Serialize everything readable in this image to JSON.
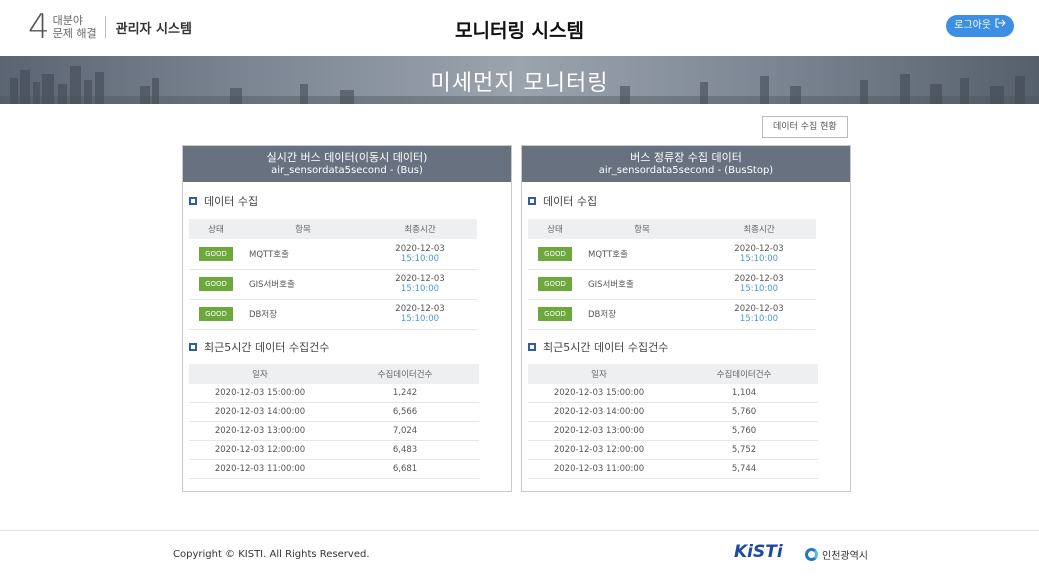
{
  "header": {
    "logo_number": "4",
    "logo_line1": "대분야",
    "logo_line2": "문제 해결",
    "admin_label": "관리자 시스템",
    "title": "모니터링 시스템",
    "logout_label": "로그아웃"
  },
  "banner": {
    "title": "미세먼지 모니터링"
  },
  "status_button": "데이터 수집 현황",
  "panels": [
    {
      "title": "실시간 버스 데이터(이동시 데이터)",
      "subtitle": "air_sensordata5second - (Bus)",
      "collect_title": "데이터 수집",
      "collect_headers": [
        "상태",
        "항목",
        "최종시간"
      ],
      "collect_rows": [
        {
          "status": "GOOD",
          "item": "MQTT호출",
          "date": "2020-12-03",
          "time": "15:10:00"
        },
        {
          "status": "GOOD",
          "item": "GIS서버호출",
          "date": "2020-12-03",
          "time": "15:10:00"
        },
        {
          "status": "GOOD",
          "item": "DB저장",
          "date": "2020-12-03",
          "time": "15:10:00"
        }
      ],
      "count_title": "최근5시간 데이터 수집건수",
      "count_headers": [
        "일자",
        "수집데이터건수"
      ],
      "count_rows": [
        {
          "date": "2020-12-03 15:00:00",
          "count": "1,242"
        },
        {
          "date": "2020-12-03 14:00:00",
          "count": "6,566"
        },
        {
          "date": "2020-12-03 13:00:00",
          "count": "7,024"
        },
        {
          "date": "2020-12-03 12:00:00",
          "count": "6,483"
        },
        {
          "date": "2020-12-03 11:00:00",
          "count": "6,681"
        }
      ]
    },
    {
      "title": "버스 정류장 수집 데이터",
      "subtitle": "air_sensordata5second - (BusStop)",
      "collect_title": "데이터 수집",
      "collect_headers": [
        "상태",
        "항목",
        "최종시간"
      ],
      "collect_rows": [
        {
          "status": "GOOD",
          "item": "MQTT호출",
          "date": "2020-12-03",
          "time": "15:10:00"
        },
        {
          "status": "GOOD",
          "item": "GIS서버호출",
          "date": "2020-12-03",
          "time": "15:10:00"
        },
        {
          "status": "GOOD",
          "item": "DB저장",
          "date": "2020-12-03",
          "time": "15:10:00"
        }
      ],
      "count_title": "최근5시간 데이터 수집건수",
      "count_headers": [
        "일자",
        "수집데이터건수"
      ],
      "count_rows": [
        {
          "date": "2020-12-03 15:00:00",
          "count": "1,104"
        },
        {
          "date": "2020-12-03 14:00:00",
          "count": "5,760"
        },
        {
          "date": "2020-12-03 13:00:00",
          "count": "5,760"
        },
        {
          "date": "2020-12-03 12:00:00",
          "count": "5,752"
        },
        {
          "date": "2020-12-03 11:00:00",
          "count": "5,744"
        }
      ]
    }
  ],
  "footer": {
    "copyright": "Copyright © KISTI. All Rights Reserved.",
    "kisti_logo": "KiSTi",
    "incheon_label": "인천광역시"
  },
  "colors": {
    "logout_bg": "#3d8fe5",
    "panel_head_bg": "#677180",
    "good_badge": "#6da83c",
    "time_blue": "#4a9bd1"
  }
}
